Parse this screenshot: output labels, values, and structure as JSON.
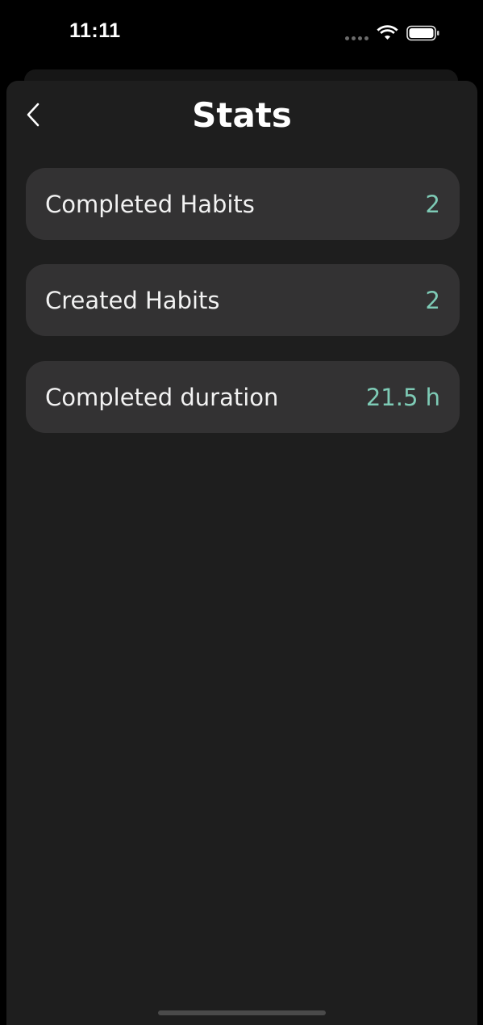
{
  "status_bar": {
    "time": "11:11"
  },
  "header": {
    "title": "Stats"
  },
  "stats": [
    {
      "label": "Completed Habits",
      "value": "2"
    },
    {
      "label": "Created Habits",
      "value": "2"
    },
    {
      "label": "Completed duration",
      "value": "21.5 h"
    }
  ],
  "colors": {
    "background": "#1e1e1e",
    "card": "#333233",
    "accent": "#7ecbb6",
    "text": "#f2f2f2"
  },
  "icons": {
    "back": "chevron-left-icon",
    "wifi": "wifi-icon",
    "battery": "battery-icon",
    "signal": "signal-dots-icon"
  }
}
